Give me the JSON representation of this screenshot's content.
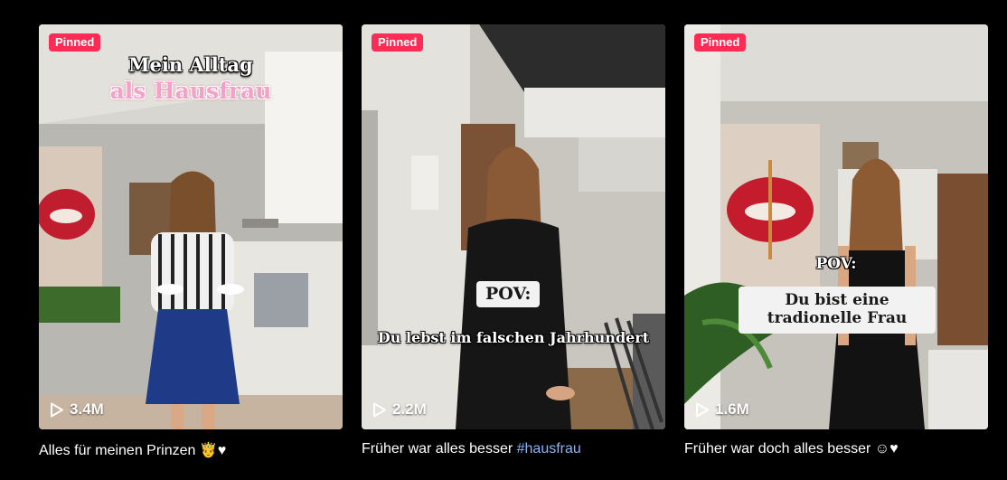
{
  "videos": [
    {
      "pinned_label": "Pinned",
      "views": "3.4M",
      "overlay_line1": "Mein Alltag",
      "overlay_line2": "als Hausfrau",
      "caption": "Alles für meinen Prinzen 🤴♥"
    },
    {
      "pinned_label": "Pinned",
      "views": "2.2M",
      "overlay_box": "POV:",
      "overlay_line": "Du lebst im falschen Jahrhundert",
      "caption_text": "Früher war alles besser ",
      "caption_hashtag": "#hausfrau"
    },
    {
      "pinned_label": "Pinned",
      "views": "1.6M",
      "overlay_line": "POV:",
      "overlay_box": "Du bist eine tradionelle Frau",
      "caption": "Früher war doch alles besser ☺♥"
    }
  ],
  "colors": {
    "background": "#000000",
    "pinned_badge": "#fe2c55",
    "hashtag": "#8ab4f8"
  },
  "icons": {
    "views": "play-outline-icon"
  }
}
